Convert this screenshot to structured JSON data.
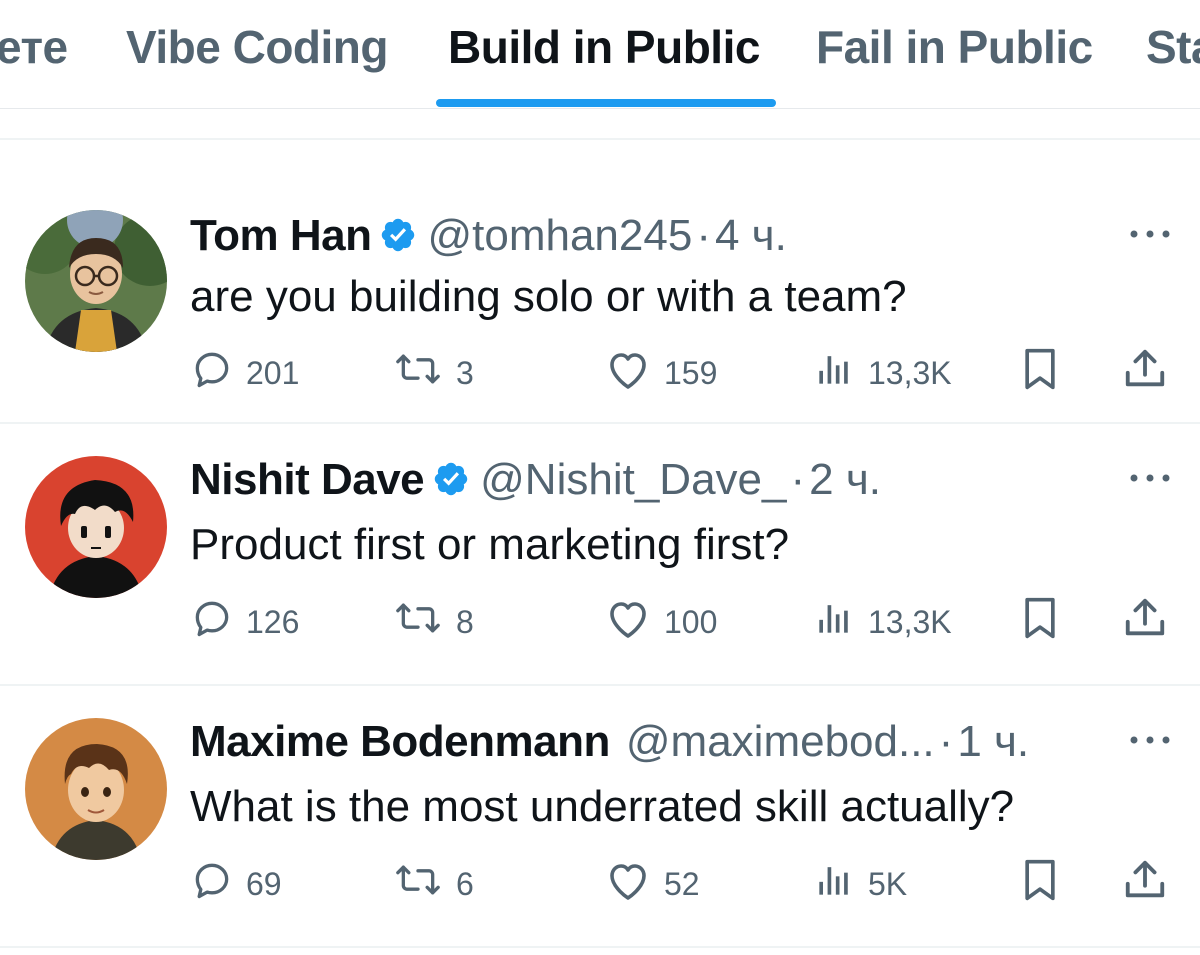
{
  "tabs": [
    {
      "label": "ете"
    },
    {
      "label": "Vibe Coding"
    },
    {
      "label": "Build in Public",
      "active": true
    },
    {
      "label": "Fail in Public"
    },
    {
      "label": "Sta"
    }
  ],
  "tweets": [
    {
      "name": "Tom Han",
      "handle": "@tomhan245",
      "time": "4 ч.",
      "text": "are you building solo or with a team?",
      "replies": "201",
      "retweets": "3",
      "likes": "159",
      "views": "13,3K"
    },
    {
      "name": "Nishit Dave",
      "handle": "@Nishit_Dave_",
      "time": "2 ч.",
      "text": "Product first or marketing first?",
      "replies": "126",
      "retweets": "8",
      "likes": "100",
      "views": "13,3K"
    },
    {
      "name": "Maxime Bodenmann",
      "handle": "@maximebod...",
      "time": "1 ч.",
      "text": "What is the most underrated skill actually?",
      "replies": "69",
      "retweets": "6",
      "likes": "52",
      "views": "5K"
    }
  ],
  "separator": "·",
  "colors": {
    "accent": "#1d9bf0",
    "secondary_text": "#536471",
    "primary_text": "#0f1419"
  },
  "icons": {
    "verified": "verified-badge-icon",
    "reply": "reply-icon",
    "retweet": "retweet-icon",
    "like": "heart-icon",
    "views": "views-icon",
    "bookmark": "bookmark-icon",
    "share": "share-icon",
    "more": "more-icon"
  }
}
